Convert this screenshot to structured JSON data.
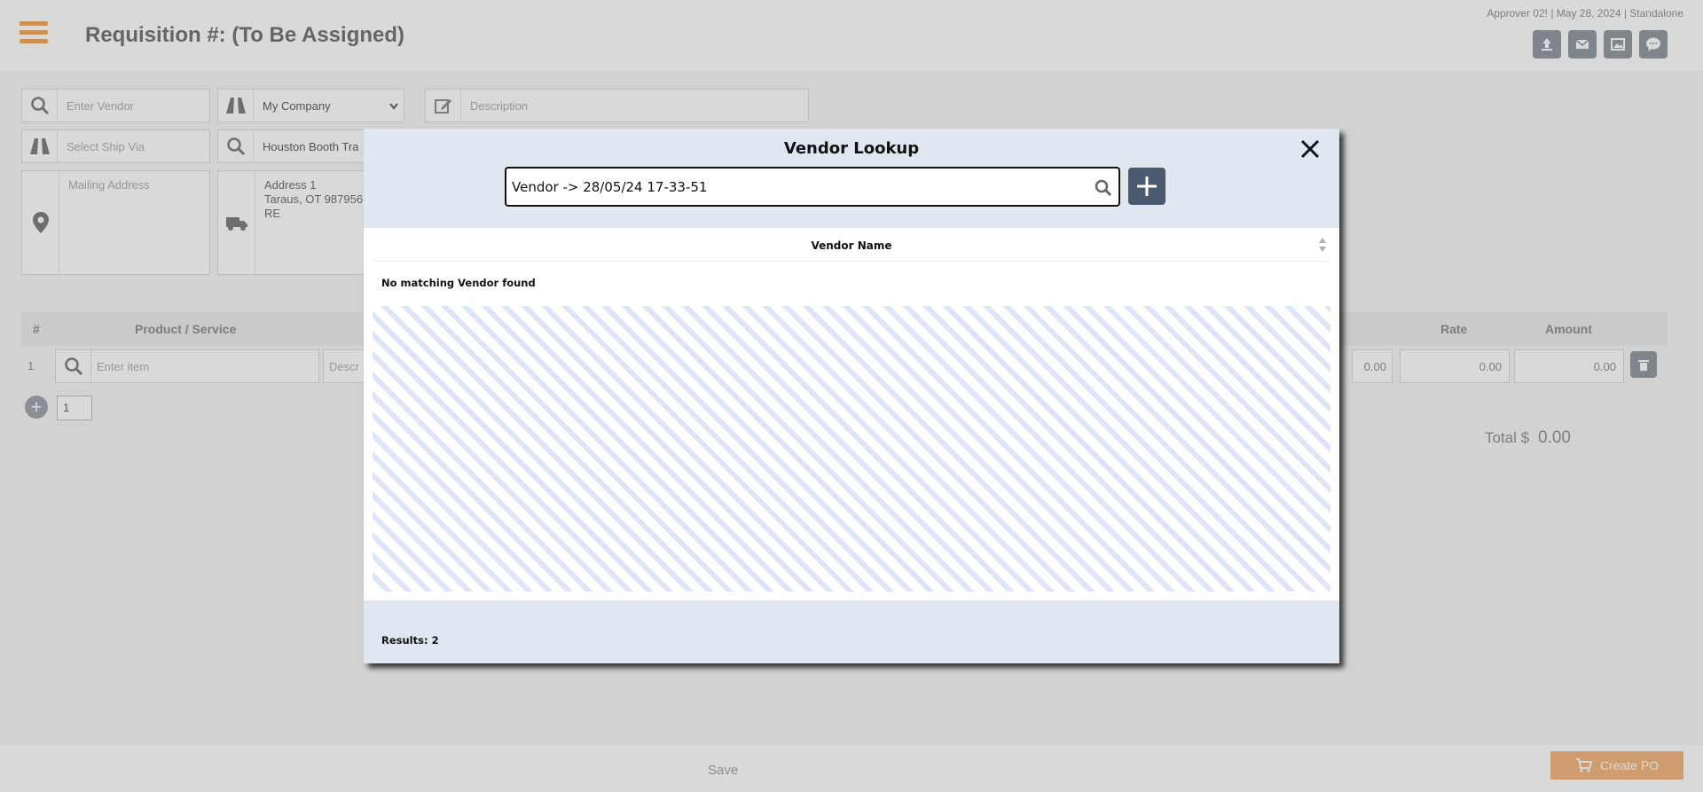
{
  "header": {
    "title": "Requisition #: (To Be Assigned)",
    "user_info": "Approver 02! | May 28, 2024 | Standalone",
    "icons": [
      "upload-icon",
      "mail-icon",
      "image-icon",
      "chat-icon"
    ]
  },
  "form": {
    "vendor_placeholder": "Enter Vendor",
    "company_value": "My Company",
    "description_placeholder": "Description",
    "ship_via_placeholder": "Select Ship Via",
    "ship_to_value": "Houston Booth Tra",
    "mailing_address_placeholder": "Mailing Address",
    "shipping_address_lines": [
      "Address 1",
      "Taraus, OT 987956",
      "RE"
    ]
  },
  "grid": {
    "headers": [
      "#",
      "Product / Service",
      "Rate",
      "Amount"
    ],
    "row": {
      "number": "1",
      "item_placeholder": "Enter item",
      "desc_placeholder": "Descr",
      "qty_value": "0.00",
      "rate_value": "0.00",
      "amount_value": "0.00"
    },
    "page_select": "1",
    "total_label": "Total $",
    "total_value": "0.00"
  },
  "footer": {
    "save_label": "Save",
    "create_po_label": "Create PO"
  },
  "modal": {
    "title": "Vendor Lookup",
    "search_value": "Vendor -> 28/05/24 17-33-51",
    "column_header": "Vendor Name",
    "empty_message": "No matching Vendor found",
    "results_label": "Results: 2"
  },
  "colors": {
    "accent_orange": "#f0a254",
    "modal_header_bg": "#e1e7f0",
    "add_button_bg": "#4b5a6e",
    "stripe_color": "#dfe4f6"
  }
}
